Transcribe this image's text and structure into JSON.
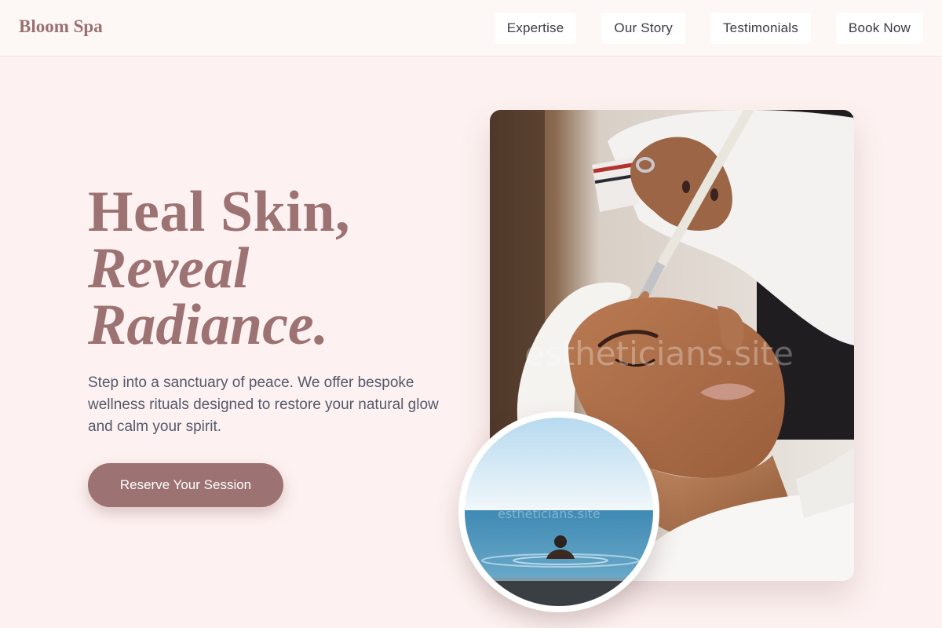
{
  "brand": {
    "name": "Bloom Spa"
  },
  "nav": {
    "items": [
      {
        "label": "Expertise"
      },
      {
        "label": "Our Story"
      },
      {
        "label": "Testimonials"
      },
      {
        "label": "Book Now"
      }
    ]
  },
  "hero": {
    "title_line1": "Heal Skin,",
    "title_line2": "Reveal",
    "title_line3": "Radiance.",
    "description": "Step into a sanctuary of peace. We offer bespoke wellness rituals designed to restore your natural glow and calm your spirit.",
    "cta_label": "Reserve Your Session"
  },
  "images": {
    "main_alt": "Esthetician applying a clay facial mask with a brush",
    "circle_alt": "Person relaxing in an infinity pool overlooking the sea",
    "watermark": "estheticians.site"
  },
  "colors": {
    "accent": "#9d7272",
    "background": "#fdf2f1",
    "header_bg": "#fdf7f6"
  }
}
